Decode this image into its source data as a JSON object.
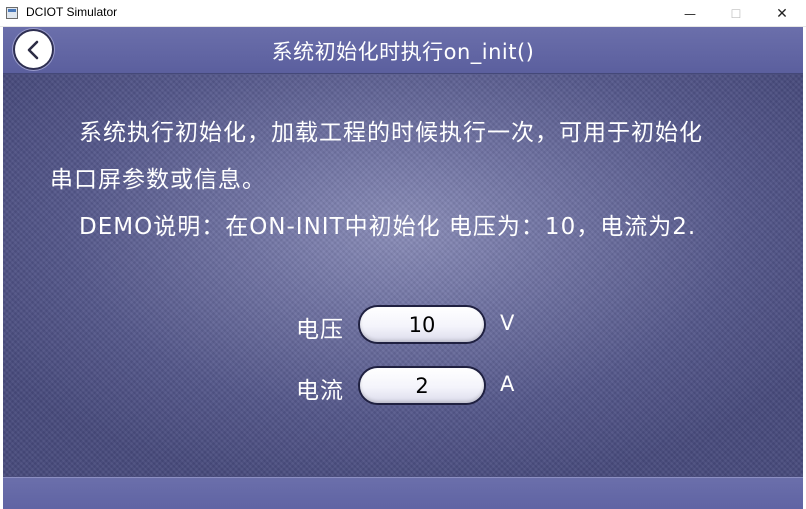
{
  "window": {
    "title": "DCIOT Simulator",
    "minimize_glyph": "—",
    "maximize_glyph": "☐",
    "close_glyph": "✕"
  },
  "header": {
    "title": "系统初始化时执行on_init()",
    "back_icon": "chevron-left-icon"
  },
  "description": {
    "line1": "系统执行初始化，加载工程的时候执行一次，可用于初始化",
    "line2": "串口屏参数或信息。",
    "line3": "DEMO说明：在ON-INIT中初始化 电压为：10，电流为2."
  },
  "fields": {
    "voltage": {
      "label": "电压",
      "value": "10",
      "unit": "V"
    },
    "current": {
      "label": "电流",
      "value": "2",
      "unit": "A"
    }
  },
  "colors": {
    "header": "#5f63a3",
    "background": "#5a5d90",
    "text": "#ffffff"
  }
}
